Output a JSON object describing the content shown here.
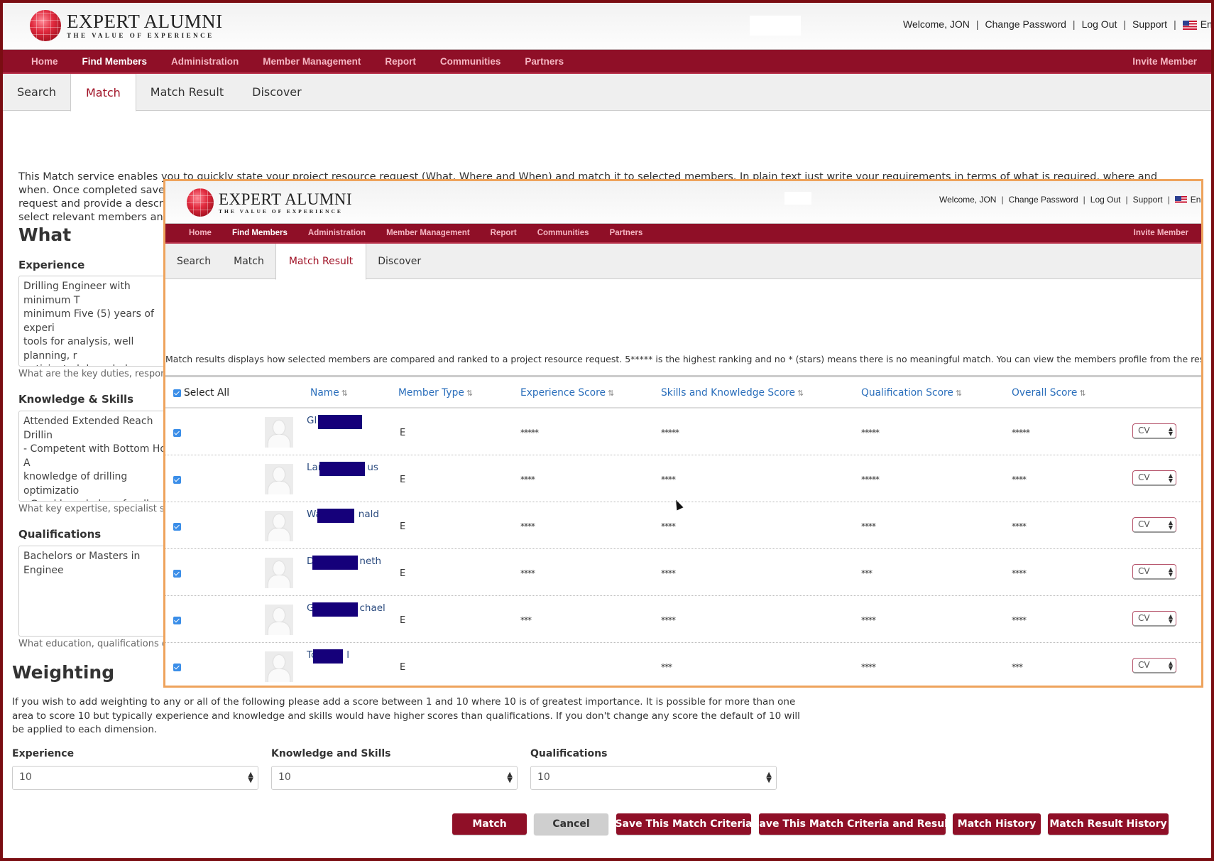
{
  "brand": {
    "name": "EXPERT ALUMNI",
    "tagline": "THE VALUE OF EXPERIENCE"
  },
  "user_links": {
    "welcome": "Welcome, JON",
    "change_password": "Change Password",
    "log_out": "Log Out",
    "support": "Support",
    "language": "English",
    "separator": "|"
  },
  "nav": {
    "items": [
      "Home",
      "Find Members",
      "Administration",
      "Member Management",
      "Report",
      "Communities",
      "Partners"
    ],
    "active": "Find Members",
    "invite": "Invite Member"
  },
  "colors": {
    "brand": "#8f0f27",
    "frame": "#7a0d12",
    "overlay_border": "#eea35c",
    "link": "#2a6ebb"
  },
  "main": {
    "tabs": [
      "Search",
      "Match",
      "Match Result",
      "Discover"
    ],
    "active_tab": "Match",
    "intro": "This Match service enables you to quickly state your project resource request (What, Where and When) and match it to selected members. In plain text just write your requirements in terms of what is required, where and when. Once completed save the request and provide a description select relevant members and the",
    "intro_lines": [
      "This Match service enables you to quickly state your project resource request (What, Where and When) and match it to selected members. In plain text just write your requirements in terms of what is required, where and when. Once completed save the",
      "request and provide a descriptio",
      "select relevant members and the"
    ],
    "what_heading": "What",
    "experience": {
      "label": "Experience",
      "value": "Drilling Engineer with minimum T\nminimum Five (5) years of experi\ntools for analysis, well planning, r\nanticipated down hole problems\n\nRoles & Responsibilities include:",
      "hint": "What are the key duties, responsibi"
    },
    "knowledge": {
      "label": "Knowledge & Skills",
      "value": "Attended Extended Reach Drillin\n- Competent with Bottom Hole A\nknowledge of drilling optimizatio\n- Good knowledge of well contro\n-Knowledge in Surface Data Logg\napplications used in the field; co",
      "hint": "What key expertise, specialist skill o"
    },
    "qualifications": {
      "label": "Qualifications",
      "value": "Bachelors or Masters in Enginee",
      "hint": "What education, qualifications or ce"
    },
    "weighting": {
      "heading": "Weighting",
      "text": "If you wish to add weighting to any or all of the following please add a score between 1 and 10 where 10 is of greatest importance. It is possible for more than one area to score 10 but typically experience and knowledge and skills would have higher scores than qualifications. If you don't change any score the default of 10 will be applied to each dimension.",
      "fields": [
        {
          "label": "Experience",
          "value": "10"
        },
        {
          "label": "Knowledge and Skills",
          "value": "10"
        },
        {
          "label": "Qualifications",
          "value": "10"
        }
      ]
    },
    "buttons": [
      "Match",
      "Cancel",
      "Save This Match Criteria",
      "Save This Match Criteria and Result",
      "Match History",
      "Match Result History"
    ]
  },
  "overlay": {
    "tabs": [
      "Search",
      "Match",
      "Match Result",
      "Discover"
    ],
    "active_tab": "Match Result",
    "description": "Match results displays how selected members are compared and ranked to a project resource request. 5***** is the highest ranking and no * (stars) means there is no meaningful match. You can view the members profile from the results.",
    "select_all": "Select All",
    "columns": [
      "Name",
      "Member Type",
      "Experience Score",
      "Skills and Knowledge Score",
      "Qualification Score",
      "Overall Score"
    ],
    "sort_icon": "⇅",
    "rows": [
      {
        "checked": true,
        "name_prefix": "Gl",
        "name_suffix": "",
        "member_type": "E",
        "experience": "*****",
        "skills": "*****",
        "qualification": "*****",
        "overall": "*****",
        "action": "CV"
      },
      {
        "checked": true,
        "name_prefix": "Lar",
        "name_suffix": "us",
        "member_type": "E",
        "experience": "****",
        "skills": "****",
        "qualification": "*****",
        "overall": "****",
        "action": "CV"
      },
      {
        "checked": true,
        "name_prefix": "Wa",
        "name_suffix": "nald",
        "member_type": "E",
        "experience": "****",
        "skills": "****",
        "qualification": "****",
        "overall": "****",
        "action": "CV"
      },
      {
        "checked": true,
        "name_prefix": "D",
        "name_suffix": "neth",
        "member_type": "E",
        "experience": "****",
        "skills": "****",
        "qualification": "***",
        "overall": "****",
        "action": "CV"
      },
      {
        "checked": true,
        "name_prefix": "G",
        "name_suffix": "chael",
        "member_type": "E",
        "experience": "***",
        "skills": "****",
        "qualification": "****",
        "overall": "****",
        "action": "CV"
      },
      {
        "checked": true,
        "name_prefix": "To",
        "name_suffix": "l",
        "member_type": "E",
        "experience": "",
        "skills": "***",
        "qualification": "****",
        "overall": "***",
        "action": "CV"
      }
    ]
  }
}
